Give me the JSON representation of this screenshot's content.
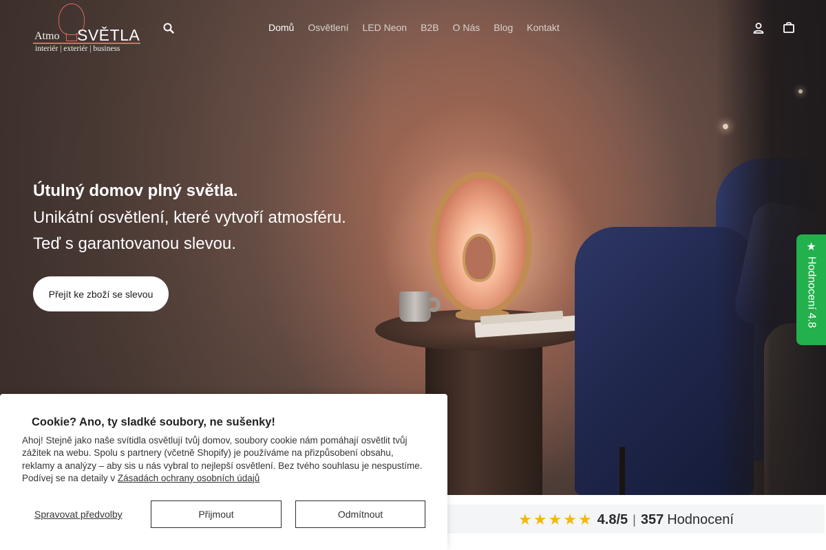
{
  "header": {
    "logo": {
      "left": "Atmo",
      "right": "SVĚTLA",
      "tagline": "interiér | exteriér | business"
    },
    "search_icon": "search-icon",
    "nav": [
      {
        "label": "Domů",
        "active": true
      },
      {
        "label": "Osvětlení",
        "active": false
      },
      {
        "label": "LED Neon",
        "active": false
      },
      {
        "label": "B2B",
        "active": false
      },
      {
        "label": "O Nás",
        "active": false
      },
      {
        "label": "Blog",
        "active": false
      },
      {
        "label": "Kontakt",
        "active": false
      }
    ],
    "account_icon": "user-icon",
    "cart_icon": "shopping-bag-icon"
  },
  "hero": {
    "title": "Útulný domov plný světla.",
    "subtitle_line1": "Unikátní osvětlení, které vytvoří atmosféru.",
    "subtitle_line2": "Teď s garantovanou slevou.",
    "cta_label": "Přejít ke zboží se slevou"
  },
  "reviews_tab": {
    "label": "Hodnocení 4.8",
    "icon": "star-icon",
    "color": "#22b14c"
  },
  "rating_bar": {
    "stars": 5,
    "score": "4.8/5",
    "separator": "|",
    "count": "357",
    "count_label": "Hodnocení",
    "star_color": "#f5b70a"
  },
  "cookie_banner": {
    "title": "Cookie? Ano, ty sladké soubory, ne sušenky!",
    "text": "Ahoj! Stejně jako naše svítidla osvětlují tvůj domov, soubory cookie nám pomáhají osvětlit tvůj zážitek na webu. Spolu s partnery (včetně Shopify) je používáme na přizpůsobení obsahu, reklamy a analýzy – aby sis u nás vybral to nejlepší osvětlení. Bez tvého souhlasu je nespustíme. Podívej se na detaily v ",
    "policy_link": "Zásadách ochrany osobních údajů",
    "manage_label": "Spravovat předvolby",
    "accept_label": "Přijmout",
    "reject_label": "Odmítnout"
  }
}
